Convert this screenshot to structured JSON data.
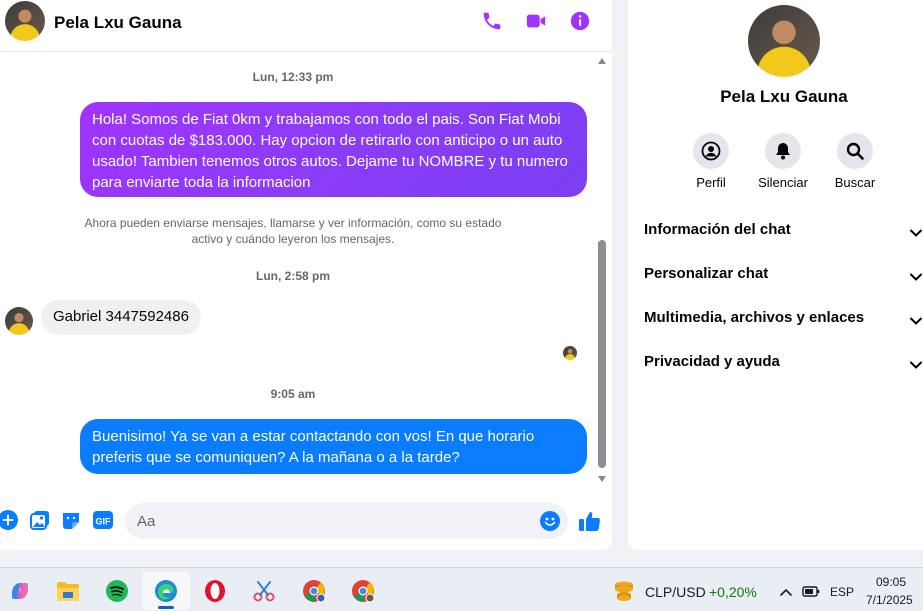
{
  "contact": {
    "name": "Pela Lxu Gauna"
  },
  "header_icons": [
    "phone-icon",
    "video-icon",
    "info-icon"
  ],
  "colors": {
    "accent": "#a033ff",
    "outgoing_gradient_start": "#a033ff",
    "outgoing_gradient_end": "#7b3ff2",
    "outgoing_blue": "#0a7cff",
    "incoming_bubble": "#f0f0f0",
    "muted_text": "#65676b"
  },
  "messages": {
    "ts1": "Lun, 12:33 pm",
    "msg1": "Hola! Somos de Fiat 0km y trabajamos con todo el pais. Son Fiat Mobi con cuotas de $183.000. Hay opcion de retirarlo con anticipo o un auto usado! Tambien tenemos otros autos. Dejame tu NOMBRE y tu numero para enviarte toda la informacion",
    "system_note": "Ahora pueden enviarse mensajes, llamarse y ver información, como su estado activo y cuándo leyeron los mensajes.",
    "ts2": "Lun, 2:58 pm",
    "msg2": "Gabriel 3447592486",
    "ts3": "9:05 am",
    "msg3": "Buenisimo! Ya se van a estar contactando con vos! En que horario preferis que se comuniquen? A la mañana o a la tarde?"
  },
  "composer": {
    "placeholder": "Aa",
    "icons": [
      "plus-icon",
      "photo-icon",
      "sticker-icon",
      "gif-icon",
      "emoji-icon",
      "like-icon"
    ]
  },
  "info_panel": {
    "name": "Pela Lxu Gauna",
    "actions": [
      {
        "label": "Perfil",
        "icon": "profile-icon"
      },
      {
        "label": "Silenciar",
        "icon": "bell-icon"
      },
      {
        "label": "Buscar",
        "icon": "search-icon"
      }
    ],
    "sections": [
      "Información del chat",
      "Personalizar chat",
      "Multimedia, archivos y enlaces",
      "Privacidad y ayuda"
    ]
  },
  "taskbar": {
    "apps": [
      "copilot-icon",
      "file-explorer-icon",
      "spotify-icon",
      "edge-icon",
      "opera-icon",
      "snipping-tool-icon",
      "chrome-profile-icon",
      "chrome-icon"
    ],
    "active_app": "edge-icon",
    "widget_currency": "CLP/USD",
    "widget_change": "+0,20%",
    "language": "ESP",
    "time": "09:05",
    "date": "7/1/2025"
  }
}
